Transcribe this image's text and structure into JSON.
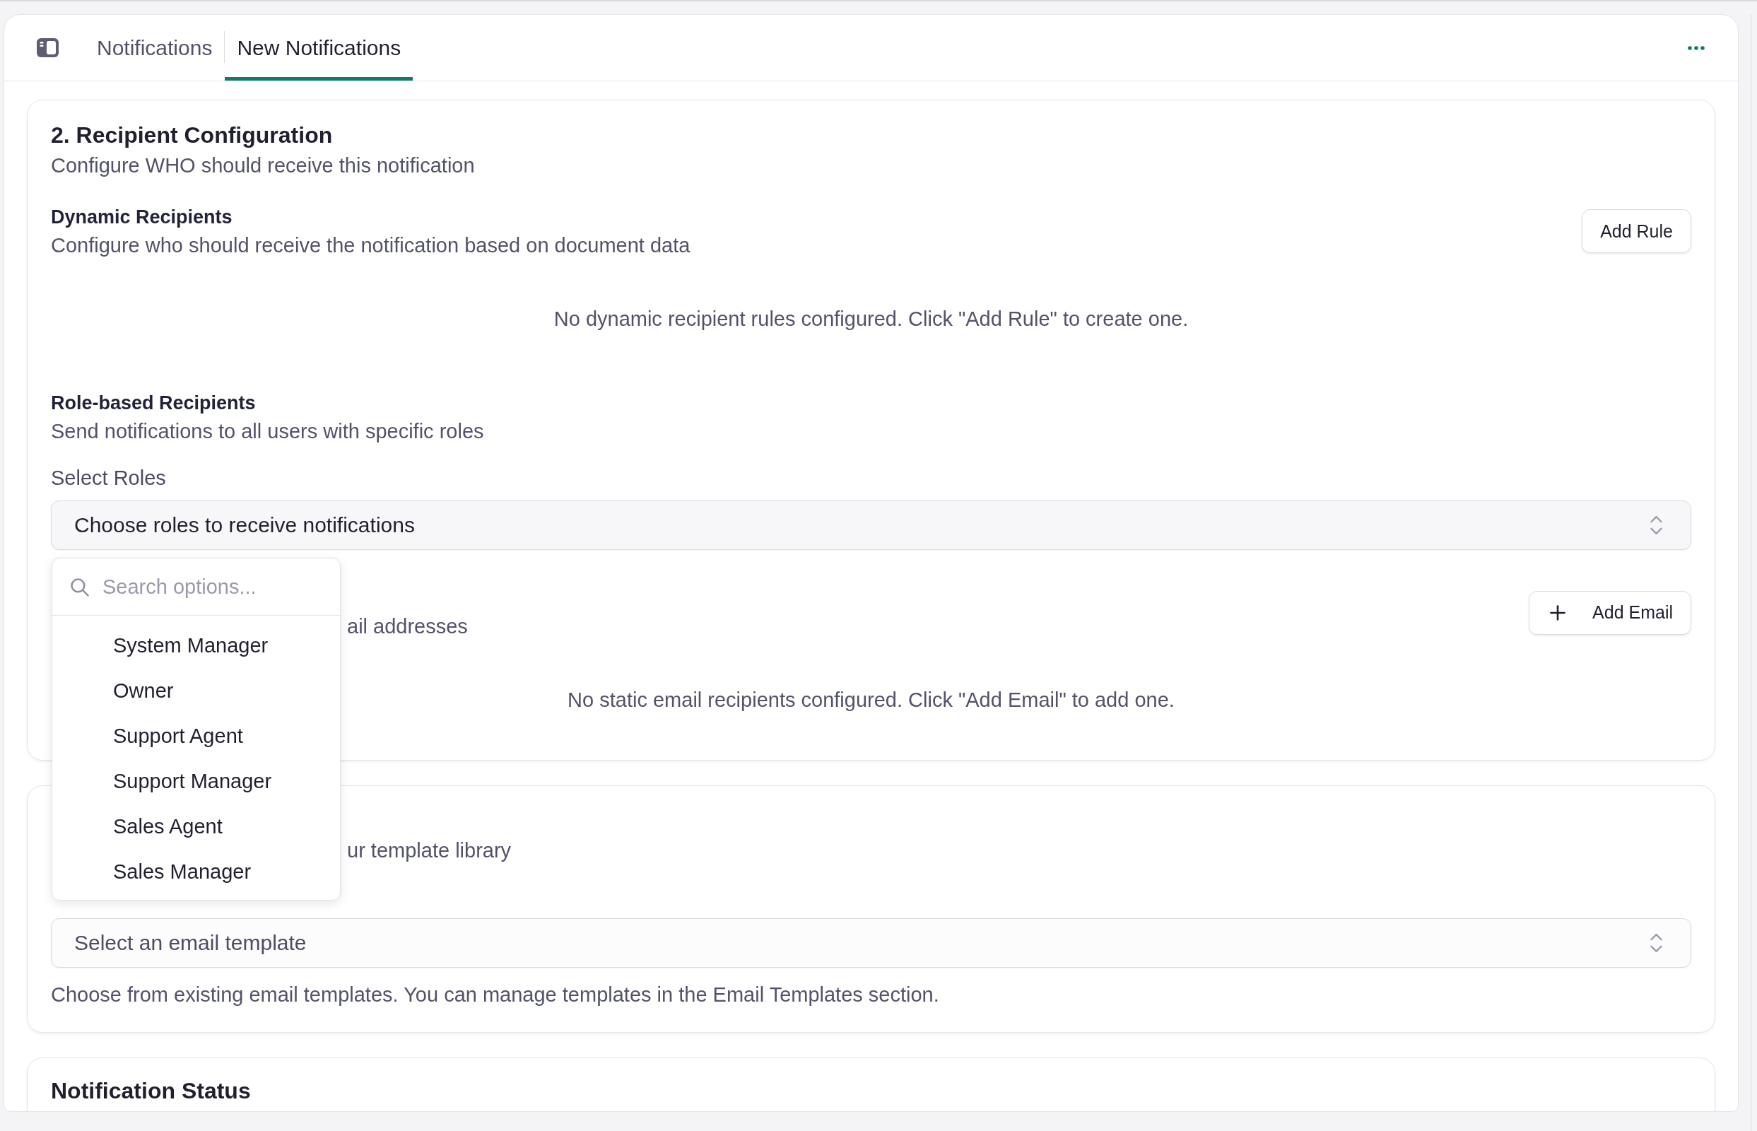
{
  "header": {
    "tabs": [
      {
        "label": "Notifications",
        "selected": false
      },
      {
        "label": "New Notifications",
        "selected": true
      }
    ]
  },
  "recipient_configuration": {
    "title": "2. Recipient Configuration",
    "subtitle": "Configure WHO should receive this notification",
    "dynamic_recipients": {
      "heading": "Dynamic Recipients",
      "description": "Configure who should receive the notification based on document data",
      "button": "Add Rule",
      "empty_message": "No dynamic recipient rules configured. Click \"Add Rule\" to create one."
    },
    "role_based_recipients": {
      "heading": "Role-based Recipients",
      "description": "Send notifications to all users with specific roles",
      "field_label": "Select Roles",
      "select": {
        "placeholder": "Choose roles to receive notifications",
        "open": true,
        "search_placeholder": "Search options...",
        "options": [
          {
            "label": "System Manager",
            "selected": false
          },
          {
            "label": "Owner",
            "selected": false
          },
          {
            "label": "Support Agent",
            "selected": false
          },
          {
            "label": "Support Manager",
            "selected": false
          },
          {
            "label": "Sales Agent",
            "selected": false
          },
          {
            "label": "Sales Manager",
            "selected": false
          }
        ]
      }
    },
    "static_recipients": {
      "description": "ail addresses",
      "button": "Add Email",
      "empty_message": "No static email recipients configured. Click \"Add Email\" to add one."
    }
  },
  "email_template": {
    "description": "ur template library",
    "select": {
      "placeholder": "Select an email template"
    },
    "help": "Choose from existing email templates. You can manage templates in the Email Templates section."
  },
  "notification_status": {
    "title": "Notification Status"
  }
}
